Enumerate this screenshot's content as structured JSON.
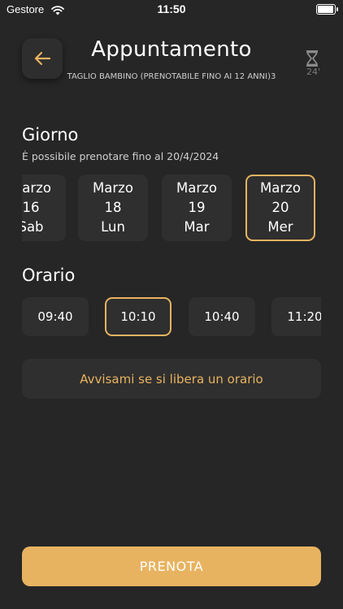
{
  "status_bar": {
    "carrier": "Gestore",
    "time": "11:50",
    "battery_level": 0.95
  },
  "header": {
    "title": "Appuntamento",
    "subtitle": "TAGLIO BAMBINO (PRENOTABILE FINO AI 12 ANNI)3",
    "timer_value": "24'"
  },
  "day_section": {
    "title": "Giorno",
    "note": "È possibile prenotare fino al 20/4/2024",
    "days": [
      {
        "month": "Marzo",
        "day": "16",
        "weekday": "Sab"
      },
      {
        "month": "Marzo",
        "day": "18",
        "weekday": "Lun"
      },
      {
        "month": "Marzo",
        "day": "19",
        "weekday": "Mar"
      },
      {
        "month": "Marzo",
        "day": "20",
        "weekday": "Mer"
      }
    ],
    "selected_index": 3
  },
  "time_section": {
    "title": "Orario",
    "times": [
      "09:40",
      "10:10",
      "10:40",
      "11:20"
    ],
    "selected_index": 1
  },
  "notify_label": "Avvisami se si libera un orario",
  "book_label": "PRENOTA",
  "colors": {
    "accent": "#e8b360",
    "background": "#262626",
    "card": "#2f2f2f"
  },
  "icons": {
    "back": "arrow-left-icon",
    "timer": "hourglass-icon",
    "wifi": "wifi-icon",
    "battery": "battery-icon"
  }
}
